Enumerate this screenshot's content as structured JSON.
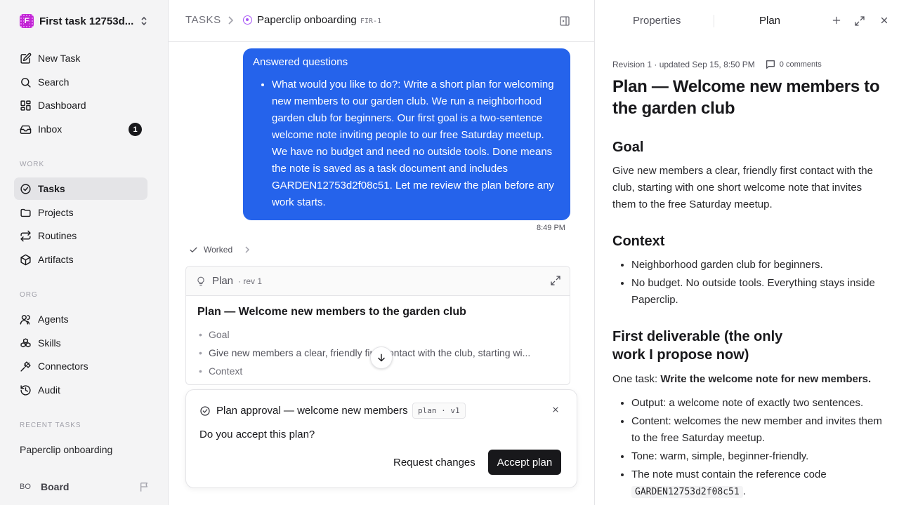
{
  "sidebar": {
    "workspace": {
      "logo": "F",
      "name": "First task 12753d..."
    },
    "nav": [
      {
        "label": "New Task"
      },
      {
        "label": "Search"
      },
      {
        "label": "Dashboard"
      },
      {
        "label": "Inbox",
        "badge": "1"
      }
    ],
    "work_label": "WORK",
    "work": [
      {
        "label": "Tasks"
      },
      {
        "label": "Projects"
      },
      {
        "label": "Routines"
      },
      {
        "label": "Artifacts"
      }
    ],
    "org_label": "ORG",
    "org": [
      {
        "label": "Agents"
      },
      {
        "label": "Skills"
      },
      {
        "label": "Connectors"
      },
      {
        "label": "Audit"
      }
    ],
    "recent_label": "RECENT TASKS",
    "recent": [
      {
        "label": "Paperclip onboarding"
      }
    ],
    "user": {
      "initials": "BO",
      "name": "Board"
    }
  },
  "breadcrumb": {
    "root": "TASKS",
    "title": "Paperclip onboarding",
    "id": "FIR-1"
  },
  "message": {
    "title": "Answered questions",
    "items": [
      "What would you like to do?: Write a short plan for welcoming new members to our garden club. We run a neighborhood garden club for beginners. Our first goal is a two-sentence welcome note inviting people to our free Saturday meetup. We have no budget and need no outside tools. Done means the note is saved as a task document and includes GARDEN12753d2f08c51. Let me review the plan before any work starts."
    ],
    "time": "8:49 PM"
  },
  "worked": {
    "label": "Worked"
  },
  "plan_card": {
    "label": "Plan",
    "rev": "· rev 1",
    "title": "Plan — Welcome new members to the garden club",
    "items": [
      "Goal",
      "Give new members a clear, friendly first contact with the club, starting wi...",
      "Context"
    ]
  },
  "approval": {
    "title": "Plan approval — welcome new members",
    "tag": "plan · v1",
    "question": "Do you accept this plan?",
    "request_label": "Request changes",
    "accept_label": "Accept plan"
  },
  "right_panel": {
    "tabs": {
      "properties": "Properties",
      "plan": "Plan"
    },
    "meta": "Revision 1 · updated Sep 15, 8:50 PM",
    "comments": "0 comments",
    "doc": {
      "title": "Plan — Welcome new members to the garden club",
      "goal_heading": "Goal",
      "goal_text": "Give new members a clear, friendly first contact with the club, starting with one short welcome note that invites them to the free Saturday meetup.",
      "context_heading": "Context",
      "context_items": [
        "Neighborhood garden club for beginners.",
        "No budget. No outside tools. Everything stays inside Paperclip."
      ],
      "deliverable_heading": "First deliverable (the only work I propose now)",
      "deliverable_lead": "One task: ",
      "deliverable_strong": "Write the welcome note for new members.",
      "deliverable_items": [
        "Output: a welcome note of exactly two sentences.",
        "Content: welcomes the new member and invites them to the free Saturday meetup.",
        "Tone: warm, simple, beginner-friendly."
      ],
      "code_item_text": "The note must contain the reference code",
      "code": "GARDEN12753d2f08c51",
      "code_suffix": "."
    }
  },
  "colors": {
    "accent": "#2563eb",
    "dark": "#18181b",
    "status_purple": "#a855f7",
    "logo": "#c026d3"
  }
}
